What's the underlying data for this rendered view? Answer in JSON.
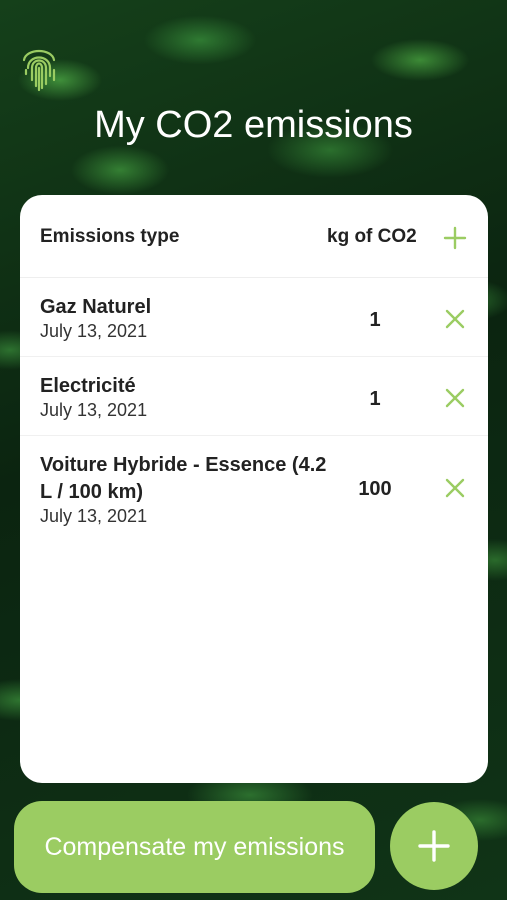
{
  "status_bar": {
    "left": "",
    "center": ""
  },
  "header": {
    "title": "My CO2 emissions"
  },
  "table": {
    "col_type": "Emissions type",
    "col_kg": "kg of CO2",
    "rows": [
      {
        "name": "Gaz Naturel",
        "date": "July 13, 2021",
        "kg": "1"
      },
      {
        "name": "Electricité",
        "date": "July 13, 2021",
        "kg": "1"
      },
      {
        "name": "Voiture Hybride - Essence (4.2 L / 100 km)",
        "date": "July 13, 2021",
        "kg": "100"
      }
    ]
  },
  "actions": {
    "compensate_label": "Compensate my emissions"
  },
  "icons": {
    "logo": "fingerprint-icon",
    "add": "plus-icon",
    "delete": "close-icon",
    "fab": "plus-icon"
  },
  "colors": {
    "accent": "#9bcc62",
    "card_bg": "#ffffff"
  }
}
